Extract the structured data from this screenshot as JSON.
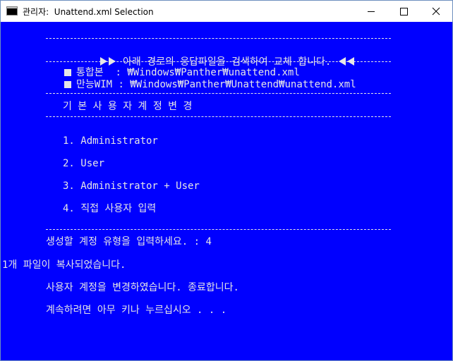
{
  "window": {
    "title": "관리자:  Unattend.xml Selection",
    "icon": "console-icon",
    "controls": [
      "minimize-icon",
      "maximize-icon",
      "close-icon"
    ]
  },
  "console": {
    "header_text": "아래 경로의 응답파일을 검색하여 교체 합니다.",
    "paths": [
      {
        "label": "통합본",
        "sep": "  : ",
        "path": "₩Windows₩Panther₩unattend.xml"
      },
      {
        "label": "만능WIM",
        "sep": " : ",
        "path": "₩Windows₩Panther₩Unattend₩unattend.xml"
      }
    ],
    "section_title": "기 본 사 용 자 계 정 변 경",
    "menu": [
      "1. Administrator",
      "2. User",
      "3. Administrator + User",
      "4. 직접 사용자 입력"
    ],
    "prompt": "생성할 계정 유형을 입력하세요. : 4",
    "copy_result": "1개 파일이 복사되었습니다.",
    "done_message": "사용자 계정을 변경하였습니다. 종료합니다.",
    "continue_message": "계속하려면 아무 키나 누르십시오 . . ."
  },
  "colors": {
    "console_background": "#0000ff",
    "console_text": "#e6e6e6",
    "titlebar": "#ffffff"
  }
}
